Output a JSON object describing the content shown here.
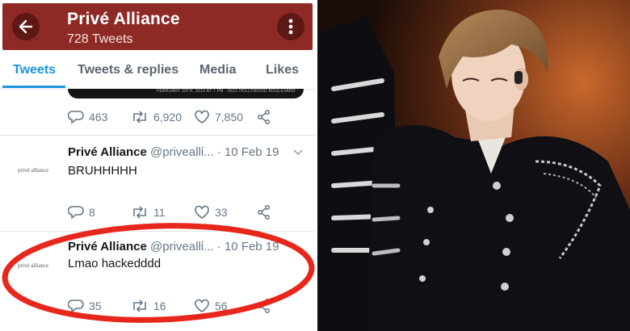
{
  "header": {
    "title": "Privé Alliance",
    "subtitle": "728 Tweets"
  },
  "tabs": [
    {
      "label": "Tweets",
      "active": true
    },
    {
      "label": "Tweets & replies",
      "active": false
    },
    {
      "label": "Media",
      "active": false
    },
    {
      "label": "Likes",
      "active": false
    }
  ],
  "media_strip_text": "FEBRUARY 20TH, 2019 AT 7 PM · 6621 HOLLYWOOD BOULEVARD",
  "first_tweet_actions": {
    "replies": "463",
    "retweets": "6,920",
    "likes": "7,850"
  },
  "tweets": [
    {
      "name": "Privé Alliance",
      "handle": "@priveallί...",
      "date": "· 10 Feb 19",
      "text": "BRUHHHHH",
      "avatar_text": "privé alliance",
      "replies": "8",
      "retweets": "11",
      "likes": "33"
    },
    {
      "name": "Privé Alliance",
      "handle": "@priveallί...",
      "date": "· 10 Feb 19",
      "text": "Lmao hackedddd",
      "avatar_text": "privé alliance",
      "replies": "35",
      "retweets": "16",
      "likes": "56"
    }
  ],
  "colors": {
    "header_bg": "#8e2a26",
    "accent_blue": "#1b95e0",
    "annotation_red": "#e8271c"
  },
  "photo": {
    "description_icon": "person-photo"
  }
}
